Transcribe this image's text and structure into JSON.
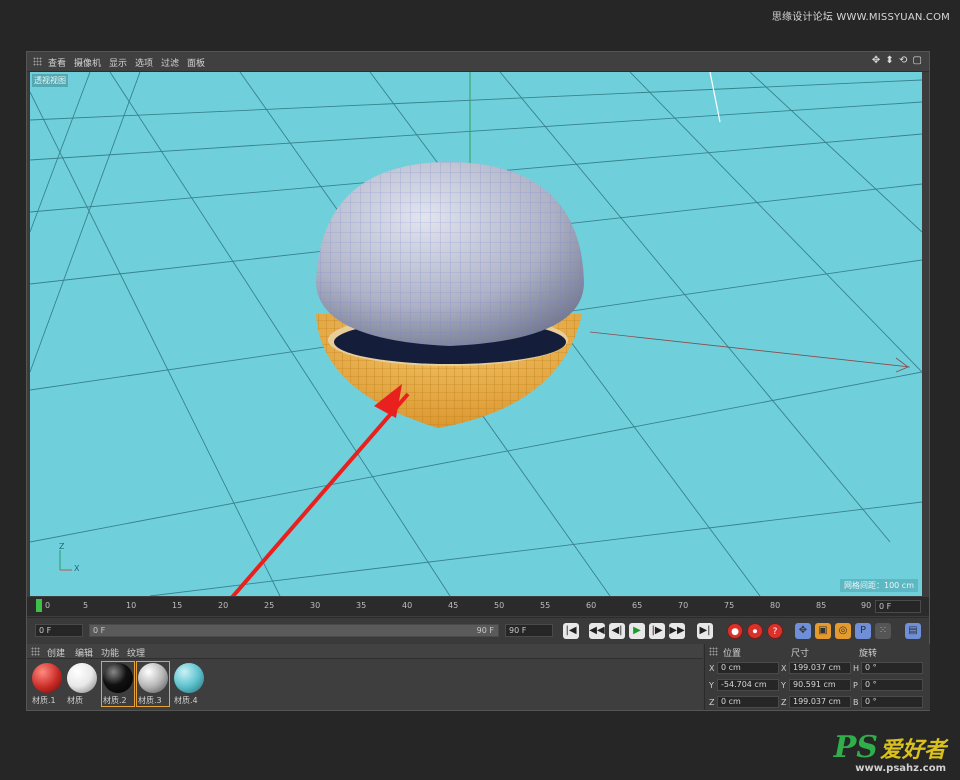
{
  "watermark": {
    "top": "思缘设计论坛 WWW.MISSYUAN.COM",
    "ps": "PS",
    "cn": "爱好者",
    "url": "www.psahz.com"
  },
  "menubar": {
    "items": [
      "查看",
      "摄像机",
      "显示",
      "选项",
      "过滤",
      "面板"
    ],
    "icons": "✥ ⬍ ⟲ ▢"
  },
  "viewport": {
    "label": "透视视图",
    "grid_info": "网格间距：100 cm",
    "axis_y": "Z",
    "axis_x": "X"
  },
  "timeline": {
    "ticks": [
      "0",
      "5",
      "10",
      "15",
      "20",
      "25",
      "30",
      "35",
      "40",
      "45",
      "50",
      "55",
      "60",
      "65",
      "70",
      "75",
      "80",
      "85",
      "90"
    ],
    "end_frame": "0 F"
  },
  "transport": {
    "current_frame": "0 F",
    "range_start": "0 F",
    "range_end": "90 F",
    "max_frame": "90 F",
    "buttons": [
      "|◀",
      "◀◀",
      "◀|",
      "▶",
      "|▶",
      "▶▶",
      "▶|"
    ]
  },
  "material_panel": {
    "menu": [
      "创建",
      "编辑",
      "功能",
      "纹理"
    ],
    "materials": [
      {
        "label": "材质.1",
        "color": "#c92a26"
      },
      {
        "label": "材质",
        "color": "#ffffff"
      },
      {
        "label": "材质.2",
        "color": "#111111"
      },
      {
        "label": "材质.3",
        "color": "#b8b8b8"
      },
      {
        "label": "材质.4",
        "color": "#5fc3cf"
      }
    ]
  },
  "coord_panel": {
    "headers": [
      "位置",
      "尺寸",
      "旋转"
    ],
    "rows": [
      {
        "axis": "X",
        "pos": "0 cm",
        "size_axis": "X",
        "size": "199.037 cm",
        "rot_axis": "H",
        "rot": "0 °"
      },
      {
        "axis": "Y",
        "pos": "-54.704 cm",
        "size_axis": "Y",
        "size": "90.591 cm",
        "rot_axis": "P",
        "rot": "0 °"
      },
      {
        "axis": "Z",
        "pos": "0 cm",
        "size_axis": "Z",
        "size": "199.037 cm",
        "rot_axis": "B",
        "rot": "0 °"
      }
    ]
  },
  "colors": {
    "viewport": "#6fd0dc",
    "arrow": "#e8211e",
    "bowl": "#e8a637",
    "sphere": "#b5b8c8"
  }
}
